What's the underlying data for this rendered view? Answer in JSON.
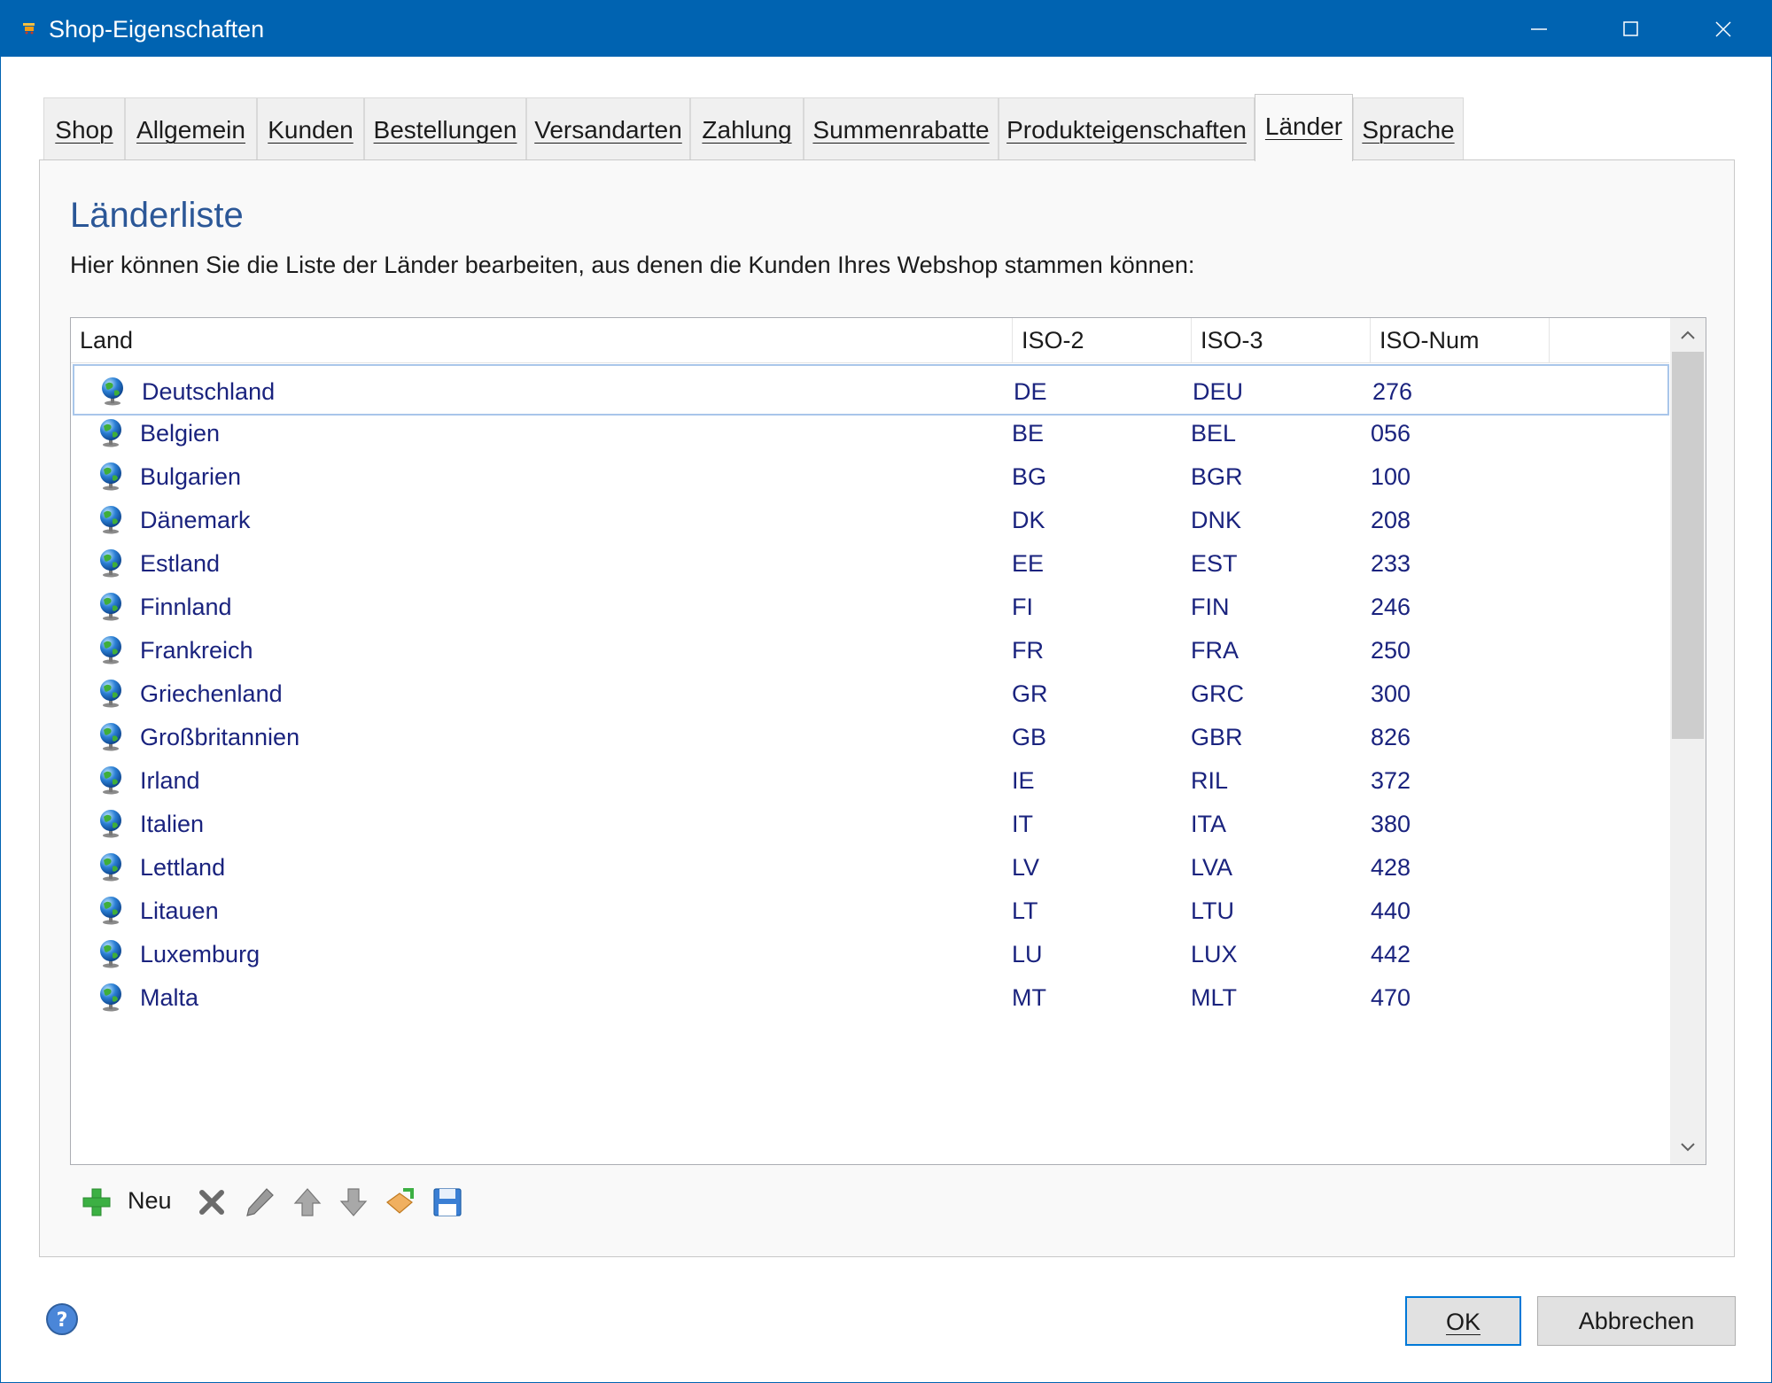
{
  "window": {
    "title": "Shop-Eigenschaften"
  },
  "tabs": [
    {
      "label": "Shop",
      "active": false
    },
    {
      "label": "Allgemein",
      "active": false
    },
    {
      "label": "Kunden",
      "active": false
    },
    {
      "label": "Bestellungen",
      "active": false
    },
    {
      "label": "Versandarten",
      "active": false
    },
    {
      "label": "Zahlung",
      "active": false
    },
    {
      "label": "Summenrabatte",
      "active": false
    },
    {
      "label": "Produkteigenschaften",
      "active": false
    },
    {
      "label": "Länder",
      "active": true
    },
    {
      "label": "Sprache",
      "active": false
    }
  ],
  "panel": {
    "heading": "Länderliste",
    "description": "Hier können Sie die Liste der Länder bearbeiten, aus denen die Kunden Ihres Webshop stammen können:"
  },
  "table": {
    "columns": [
      "Land",
      "ISO-2",
      "ISO-3",
      "ISO-Num"
    ],
    "rows": [
      {
        "land": "Deutschland",
        "iso2": "DE",
        "iso3": "DEU",
        "num": "276",
        "selected": true
      },
      {
        "land": "Belgien",
        "iso2": "BE",
        "iso3": "BEL",
        "num": "056"
      },
      {
        "land": "Bulgarien",
        "iso2": "BG",
        "iso3": "BGR",
        "num": "100"
      },
      {
        "land": "Dänemark",
        "iso2": "DK",
        "iso3": "DNK",
        "num": "208"
      },
      {
        "land": "Estland",
        "iso2": "EE",
        "iso3": "EST",
        "num": "233"
      },
      {
        "land": "Finnland",
        "iso2": "FI",
        "iso3": "FIN",
        "num": "246"
      },
      {
        "land": "Frankreich",
        "iso2": "FR",
        "iso3": "FRA",
        "num": "250"
      },
      {
        "land": "Griechenland",
        "iso2": "GR",
        "iso3": "GRC",
        "num": "300"
      },
      {
        "land": "Großbritannien",
        "iso2": "GB",
        "iso3": "GBR",
        "num": "826"
      },
      {
        "land": "Irland",
        "iso2": "IE",
        "iso3": "RIL",
        "num": "372"
      },
      {
        "land": "Italien",
        "iso2": "IT",
        "iso3": "ITA",
        "num": "380"
      },
      {
        "land": "Lettland",
        "iso2": "LV",
        "iso3": "LVA",
        "num": "428"
      },
      {
        "land": "Litauen",
        "iso2": "LT",
        "iso3": "LTU",
        "num": "440"
      },
      {
        "land": "Luxemburg",
        "iso2": "LU",
        "iso3": "LUX",
        "num": "442"
      },
      {
        "land": "Malta",
        "iso2": "MT",
        "iso3": "MLT",
        "num": "470"
      }
    ]
  },
  "toolbar": {
    "new_label": "Neu",
    "icons": [
      "add-icon",
      "delete-icon",
      "edit-icon",
      "move-up-icon",
      "move-down-icon",
      "import-icon",
      "save-icon"
    ]
  },
  "footer": {
    "ok_label": "OK",
    "cancel_label": "Abbrechen",
    "help_icon": "help-icon"
  },
  "colors": {
    "titlebar": "#0063b1",
    "heading": "#2b5797",
    "row_text": "#1a237e",
    "selection_border": "#a9c6ea",
    "ok_border": "#0078d7"
  }
}
